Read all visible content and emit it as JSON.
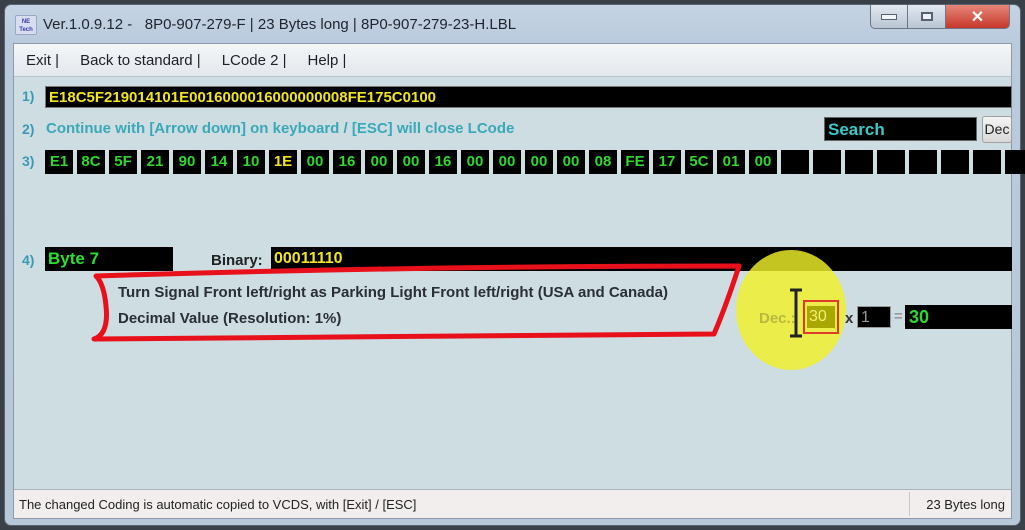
{
  "window": {
    "logo_text": "NE Tech",
    "title": "Ver.1.0.9.12 -   8P0-907-279-F | 23 Bytes long | 8P0-907-279-23-H.LBL",
    "controls": {
      "minimize": "minimize",
      "maximize": "maximize",
      "close": "✕"
    }
  },
  "menu": [
    {
      "label": "Exit |"
    },
    {
      "label": "Back to standard |"
    },
    {
      "label": "LCode 2 |"
    },
    {
      "label": "Help |"
    }
  ],
  "rows": {
    "row1_label": "1)",
    "row2_label": "2)",
    "row3_label": "3)",
    "row4_label": "4)"
  },
  "coding": "E18C5F219014101E0016000016000000008FE175C0100",
  "hint": "Continue with [Arrow down] on keyboard / [ESC] will close LCode",
  "search": {
    "value": "Search",
    "dec_button": "Dec"
  },
  "bytes": [
    {
      "value": "E1",
      "selected": false
    },
    {
      "value": "8C",
      "selected": false
    },
    {
      "value": "5F",
      "selected": false
    },
    {
      "value": "21",
      "selected": false
    },
    {
      "value": "90",
      "selected": false
    },
    {
      "value": "14",
      "selected": false
    },
    {
      "value": "10",
      "selected": false
    },
    {
      "value": "1E",
      "selected": true
    },
    {
      "value": "00",
      "selected": false
    },
    {
      "value": "16",
      "selected": false
    },
    {
      "value": "00",
      "selected": false
    },
    {
      "value": "00",
      "selected": false
    },
    {
      "value": "16",
      "selected": false
    },
    {
      "value": "00",
      "selected": false
    },
    {
      "value": "00",
      "selected": false
    },
    {
      "value": "00",
      "selected": false
    },
    {
      "value": "00",
      "selected": false
    },
    {
      "value": "08",
      "selected": false
    },
    {
      "value": "FE",
      "selected": false
    },
    {
      "value": "17",
      "selected": false
    },
    {
      "value": "5C",
      "selected": false
    },
    {
      "value": "01",
      "selected": false
    },
    {
      "value": "00",
      "selected": false
    },
    {
      "value": "",
      "selected": false
    },
    {
      "value": "",
      "selected": false
    },
    {
      "value": "",
      "selected": false
    },
    {
      "value": "",
      "selected": false
    },
    {
      "value": "",
      "selected": false
    },
    {
      "value": "",
      "selected": false
    },
    {
      "value": "",
      "selected": false
    },
    {
      "value": "",
      "selected": false
    }
  ],
  "byte_detail": {
    "byte_label": "Byte 7",
    "binary_label": "Binary:",
    "binary_value": "00011110",
    "description": "Turn Signal Front left/right as Parking Light Front left/right (USA and Canada)",
    "value_type": "Decimal Value (Resolution: 1%)",
    "dec_label": "Dec.:",
    "dec_value": "30",
    "times": "x",
    "factor": "1",
    "equals": "=",
    "result": "30"
  },
  "status": {
    "left": "The changed Coding is automatic copied to VCDS, with [Exit] / [ESC]",
    "right": "23 Bytes long"
  },
  "colors": {
    "field_bg": "#000000",
    "hex_green": "#2ed82e",
    "selected_yellow": "#f2e520",
    "label_teal": "#3a9ab4",
    "annotation_red": "#e8101a",
    "highlight_yellow": "#f0f028"
  }
}
